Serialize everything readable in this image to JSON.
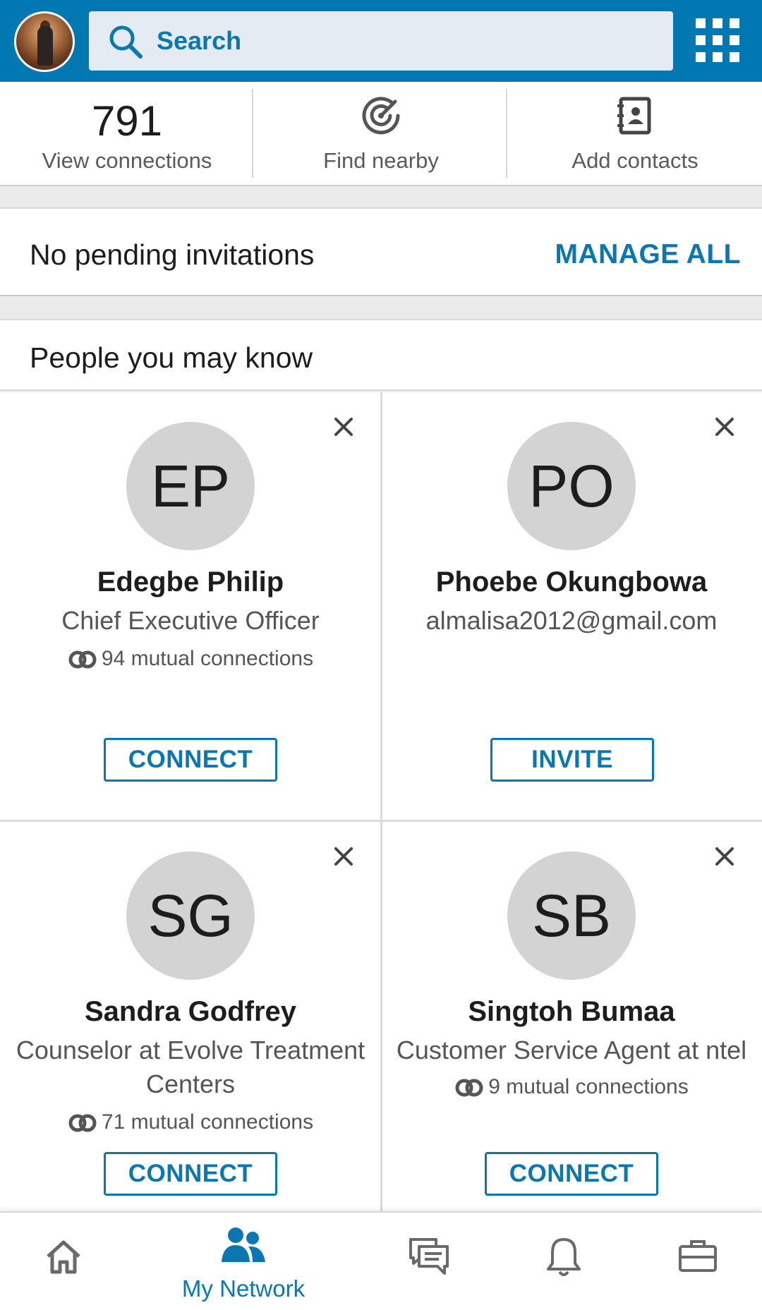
{
  "header": {
    "search_placeholder": "Search",
    "avatar_icon": "profile-photo",
    "apps_icon": "grid-icon"
  },
  "stats": {
    "connections_count": "791",
    "connections_label": "View connections",
    "nearby_label": "Find nearby",
    "add_contacts_label": "Add contacts"
  },
  "invitations": {
    "text": "No pending invitations",
    "manage_label": "MANAGE ALL"
  },
  "pymk": {
    "title": "People you may know",
    "cards": [
      {
        "initials": "EP",
        "name": "Edegbe Philip",
        "headline": "Chief Executive Officer",
        "mutual": "94 mutual connections",
        "action": "CONNECT"
      },
      {
        "initials": "PO",
        "name": "Phoebe Okungbowa",
        "headline": "almalisa2012@gmail.com",
        "mutual": "",
        "action": "INVITE"
      },
      {
        "initials": "SG",
        "name": "Sandra Godfrey",
        "headline": "Counselor at Evolve Treatment Centers",
        "mutual": "71 mutual connections",
        "action": "CONNECT"
      },
      {
        "initials": "SB",
        "name": "Singtoh Bumaa",
        "headline": "Customer Service Agent at ntel",
        "mutual": "9 mutual connections",
        "action": "CONNECT"
      }
    ]
  },
  "bottom_nav": {
    "active_label": "My Network",
    "items": [
      "home-icon",
      "my-network-icon",
      "messaging-icon",
      "notifications-icon",
      "jobs-icon"
    ]
  },
  "colors": {
    "brand_blue": "#0278b3",
    "link_blue": "#0a77b0",
    "avatar_gray": "#d3d3d3"
  }
}
